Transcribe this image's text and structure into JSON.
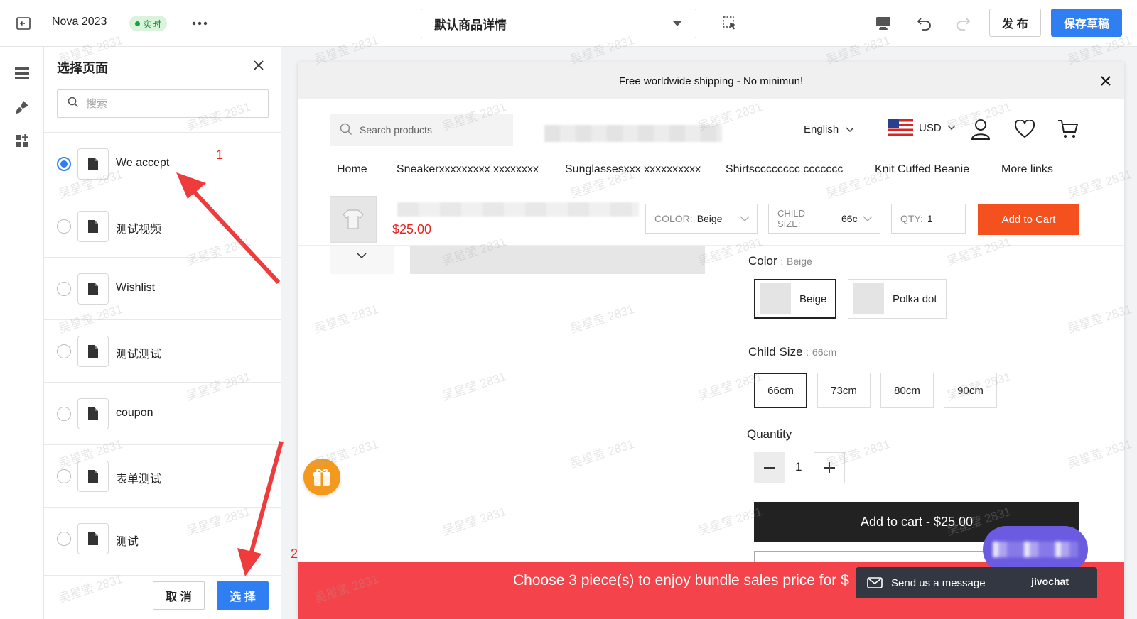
{
  "toolbar": {
    "project_name": "Nova 2023",
    "live_badge": "实时",
    "template_select": "默认商品详情",
    "publish_label": "发 布",
    "save_draft_label": "保存草稿"
  },
  "panel": {
    "title": "选择页面",
    "search_placeholder": "搜索",
    "items": [
      {
        "label": "We accept",
        "selected": true
      },
      {
        "label": "测试视频",
        "selected": false
      },
      {
        "label": "Wishlist",
        "selected": false
      },
      {
        "label": "测试测试",
        "selected": false
      },
      {
        "label": "coupon",
        "selected": false
      },
      {
        "label": "表单测试",
        "selected": false
      },
      {
        "label": "测试",
        "selected": false
      }
    ],
    "cancel_label": "取 消",
    "select_label": "选 择"
  },
  "annotations": {
    "step1": "1",
    "step2": "2"
  },
  "store": {
    "announcement": "Free worldwide shipping - No minimun!",
    "search_placeholder": "Search products",
    "language": "English",
    "currency": "USD",
    "nav": [
      "Home",
      "Sneakerxxxxxxxxx xxxxxxxx",
      "Sunglassesxxx xxxxxxxxxx",
      "Shirtscccccccc ccccccc",
      "Knit Cuffed Beanie",
      "More links"
    ],
    "sticky": {
      "price": "$25.00",
      "color_label": "COLOR:",
      "color_value": "Beige",
      "size_label_line1": "CHILD",
      "size_label_line2": "SIZE:",
      "size_value": "66c",
      "qty_label": "QTY:",
      "qty_value": "1",
      "add_label": "Add to Cart"
    },
    "color": {
      "label": "Color",
      "selected": "Beige",
      "options": [
        "Beige",
        "Polka dot"
      ]
    },
    "child_size": {
      "label": "Child Size",
      "selected": "66cm",
      "options": [
        "66cm",
        "73cm",
        "80cm",
        "90cm"
      ]
    },
    "quantity": {
      "label": "Quantity",
      "value": "1"
    },
    "add_to_cart": "Add to cart - $25.00",
    "bundle_text": "Choose 3 piece(s) to enjoy bundle sales price for $",
    "chat": {
      "label": "Send us a message",
      "brand": "jivochat"
    }
  },
  "watermark": "吴星莹 2831",
  "colors": {
    "primary": "#2f7ff2",
    "live_green": "#1f9e41",
    "sticky_add": "#f4511e",
    "bundle_bar": "#f4434a",
    "price_red": "#e8231f",
    "annotation": "#e8231f"
  }
}
